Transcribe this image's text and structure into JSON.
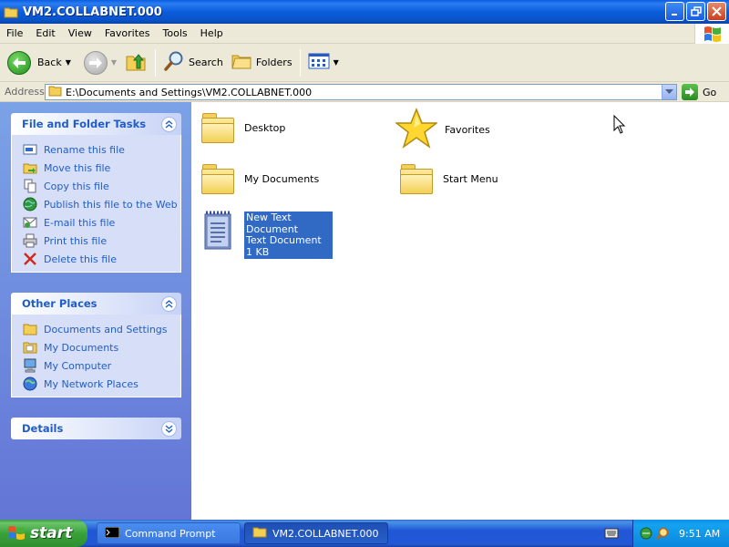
{
  "window": {
    "title": "VM2.COLLABNET.000"
  },
  "menu": [
    "File",
    "Edit",
    "View",
    "Favorites",
    "Tools",
    "Help"
  ],
  "toolbar": {
    "back": "Back",
    "search": "Search",
    "folders": "Folders"
  },
  "address": {
    "label": "Address",
    "path": "E:\\Documents and Settings\\VM2.COLLABNET.000",
    "go": "Go"
  },
  "tasks_panel": {
    "title": "File and Folder Tasks",
    "items": [
      {
        "label": "Rename this file",
        "icon": "rename-icon"
      },
      {
        "label": "Move this file",
        "icon": "move-icon"
      },
      {
        "label": "Copy this file",
        "icon": "copy-icon"
      },
      {
        "label": "Publish this file to the Web",
        "icon": "publish-web-icon"
      },
      {
        "label": "E-mail this file",
        "icon": "email-icon"
      },
      {
        "label": "Print this file",
        "icon": "printer-icon"
      },
      {
        "label": "Delete this file",
        "icon": "delete-x-icon"
      }
    ]
  },
  "places_panel": {
    "title": "Other Places",
    "items": [
      {
        "label": "Documents and Settings",
        "icon": "folder-icon"
      },
      {
        "label": "My Documents",
        "icon": "my-documents-icon"
      },
      {
        "label": "My Computer",
        "icon": "my-computer-icon"
      },
      {
        "label": "My Network Places",
        "icon": "network-places-icon"
      }
    ]
  },
  "details_panel": {
    "title": "Details"
  },
  "files": [
    {
      "name": "Desktop",
      "icon": "folder-icon"
    },
    {
      "name": "Favorites",
      "icon": "star-icon"
    },
    {
      "name": "My Documents",
      "icon": "folder-icon"
    },
    {
      "name": "Start Menu",
      "icon": "folder-icon"
    }
  ],
  "selected_file": {
    "name": "New Text Document",
    "type": "Text Document",
    "size": "1 KB",
    "icon": "text-document-icon"
  },
  "taskbar": {
    "start": "start",
    "buttons": [
      "Command Prompt",
      "VM2.COLLABNET.000"
    ],
    "clock": "9:51 AM"
  },
  "colors": {
    "titlebar": "#0b5ddc",
    "taskpane_link": "#215dc6",
    "selection": "#316ac5",
    "start_green": "#3aa13a"
  }
}
